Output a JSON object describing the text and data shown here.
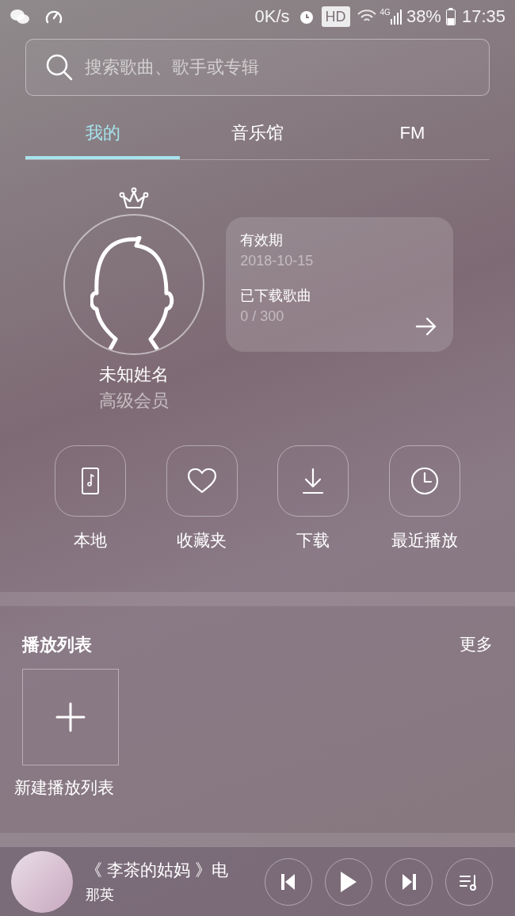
{
  "status_bar": {
    "speed": "0K/s",
    "hd": "HD",
    "network": "4G",
    "battery": "38%",
    "time": "17:35"
  },
  "search": {
    "placeholder": "搜索歌曲、歌手或专辑"
  },
  "tabs": [
    {
      "label": "我的",
      "selected": true
    },
    {
      "label": "音乐馆",
      "selected": false
    },
    {
      "label": "FM",
      "selected": false
    }
  ],
  "profile": {
    "name": "未知姓名",
    "level": "高级会员",
    "vip": true
  },
  "membership_card": {
    "expiry_label": "有效期",
    "expiry": "2018-10-15",
    "downloads_label": "已下载歌曲",
    "downloads": "0 / 300"
  },
  "shortcuts": [
    {
      "kind": "local",
      "label": "本地"
    },
    {
      "kind": "favorites",
      "label": "收藏夹"
    },
    {
      "kind": "download",
      "label": "下载"
    },
    {
      "kind": "recent",
      "label": "最近播放"
    }
  ],
  "playlists": {
    "title": "播放列表",
    "more": "更多",
    "new_label": "新建播放列表"
  },
  "now_playing": {
    "title": "《 李茶的姑妈 》电",
    "artist": "那英",
    "playing": false
  }
}
